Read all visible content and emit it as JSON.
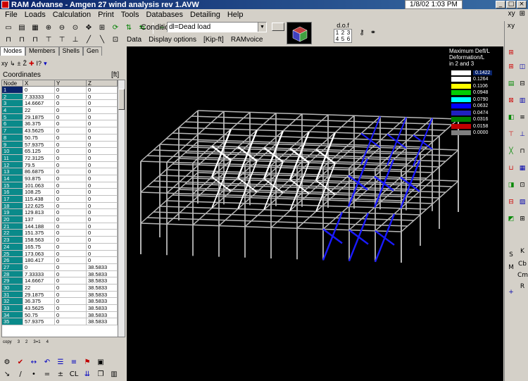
{
  "window": {
    "title": "RAM Advanse - Amgen 27 wind analysis rev 1.AVW",
    "clock": "1/8/02  1:03 PM",
    "buttons": {
      "minimize": "_",
      "maximize": "□",
      "close": "×"
    }
  },
  "menu": [
    "File",
    "Loads",
    "Calculation",
    "Print",
    "Tools",
    "Databases",
    "Detailing",
    "Help"
  ],
  "toolbar": {
    "condition_label": "Condition:",
    "condition_value": "dl=Dead load",
    "data_tab": "Data",
    "display_options": "Display options",
    "units": "[Kip-ft]",
    "ramvoice": "RAMvoice",
    "dof_label": "d.o.f",
    "dof_values": [
      "1",
      "2",
      "3",
      "4",
      "5",
      "6"
    ],
    "menu_right": [
      "xy",
      "⊞"
    ]
  },
  "left_panel": {
    "tabs": [
      "Nodes",
      "Members",
      "Shells",
      "Gen"
    ],
    "active_tab": "Nodes",
    "tools": [
      "xy",
      "↳",
      "±",
      "Ž",
      "✚",
      "I?",
      "▾"
    ],
    "title": "Coordinates",
    "unit": "[ft]",
    "columns": [
      "Node",
      "X",
      "Y",
      "Z"
    ],
    "rows": [
      [
        "1",
        "0",
        "0",
        "0"
      ],
      [
        "2",
        "7.33333",
        "0",
        "0"
      ],
      [
        "3",
        "14.6667",
        "0",
        "0"
      ],
      [
        "4",
        "22",
        "0",
        "0"
      ],
      [
        "5",
        "29.1875",
        "0",
        "0"
      ],
      [
        "6",
        "36.375",
        "0",
        "0"
      ],
      [
        "7",
        "43.5625",
        "0",
        "0"
      ],
      [
        "8",
        "50.75",
        "0",
        "0"
      ],
      [
        "9",
        "57.9375",
        "0",
        "0"
      ],
      [
        "10",
        "65.125",
        "0",
        "0"
      ],
      [
        "11",
        "72.3125",
        "0",
        "0"
      ],
      [
        "12",
        "79.5",
        "0",
        "0"
      ],
      [
        "13",
        "86.6875",
        "0",
        "0"
      ],
      [
        "14",
        "93.875",
        "0",
        "0"
      ],
      [
        "15",
        "101.063",
        "0",
        "0"
      ],
      [
        "16",
        "108.25",
        "0",
        "0"
      ],
      [
        "17",
        "115.438",
        "0",
        "0"
      ],
      [
        "18",
        "122.625",
        "0",
        "0"
      ],
      [
        "19",
        "129.813",
        "0",
        "0"
      ],
      [
        "20",
        "137",
        "0",
        "0"
      ],
      [
        "21",
        "144.188",
        "0",
        "0"
      ],
      [
        "22",
        "151.375",
        "0",
        "0"
      ],
      [
        "23",
        "158.563",
        "0",
        "0"
      ],
      [
        "24",
        "165.75",
        "0",
        "0"
      ],
      [
        "25",
        "173.063",
        "0",
        "0"
      ],
      [
        "26",
        "180.417",
        "0",
        "0"
      ],
      [
        "27",
        "0",
        "0",
        "38.5833"
      ],
      [
        "28",
        "7.33333",
        "0",
        "38.5833"
      ],
      [
        "29",
        "14.6667",
        "0",
        "38.5833"
      ],
      [
        "30",
        "22",
        "0",
        "38.5833"
      ],
      [
        "31",
        "29.1875",
        "0",
        "38.5833"
      ],
      [
        "32",
        "36.375",
        "0",
        "38.5833"
      ],
      [
        "33",
        "43.5625",
        "0",
        "38.5833"
      ],
      [
        "34",
        "50.75",
        "0",
        "38.5833"
      ],
      [
        "35",
        "57.9375",
        "0",
        "38.5833"
      ]
    ],
    "bottom_labels": [
      "copy",
      "3",
      "2",
      "3=1",
      "4"
    ]
  },
  "legend": {
    "title_lines": [
      "Maximum Defl/L",
      "Deformation/L",
      "in 2 and 3"
    ],
    "entries": [
      {
        "value": "0.1422",
        "color": "#ffffff"
      },
      {
        "value": "0.1264",
        "color": "#ffffff"
      },
      {
        "value": "0.1106",
        "color": "#ffff00"
      },
      {
        "value": "0.0948",
        "color": "#00cc00"
      },
      {
        "value": "0.0790",
        "color": "#00ffff"
      },
      {
        "value": "0.0632",
        "color": "#0000ff"
      },
      {
        "value": "0.0474",
        "color": "#2020c0"
      },
      {
        "value": "0.0316",
        "color": "#008000"
      },
      {
        "value": "0.0158",
        "color": "#c00000"
      },
      {
        "value": "0.0000",
        "color": "#808080"
      }
    ]
  },
  "colors": {
    "frame_gray": "#b8b8b8",
    "high_defl": "#ffffff",
    "brace_blue": "#1a1aff",
    "viewport_bg": "#000000"
  },
  "right_toolbar_icons": [
    "xy",
    "⊞",
    "S",
    "M",
    "K",
    "Cb",
    "Cm",
    "R",
    "+"
  ]
}
